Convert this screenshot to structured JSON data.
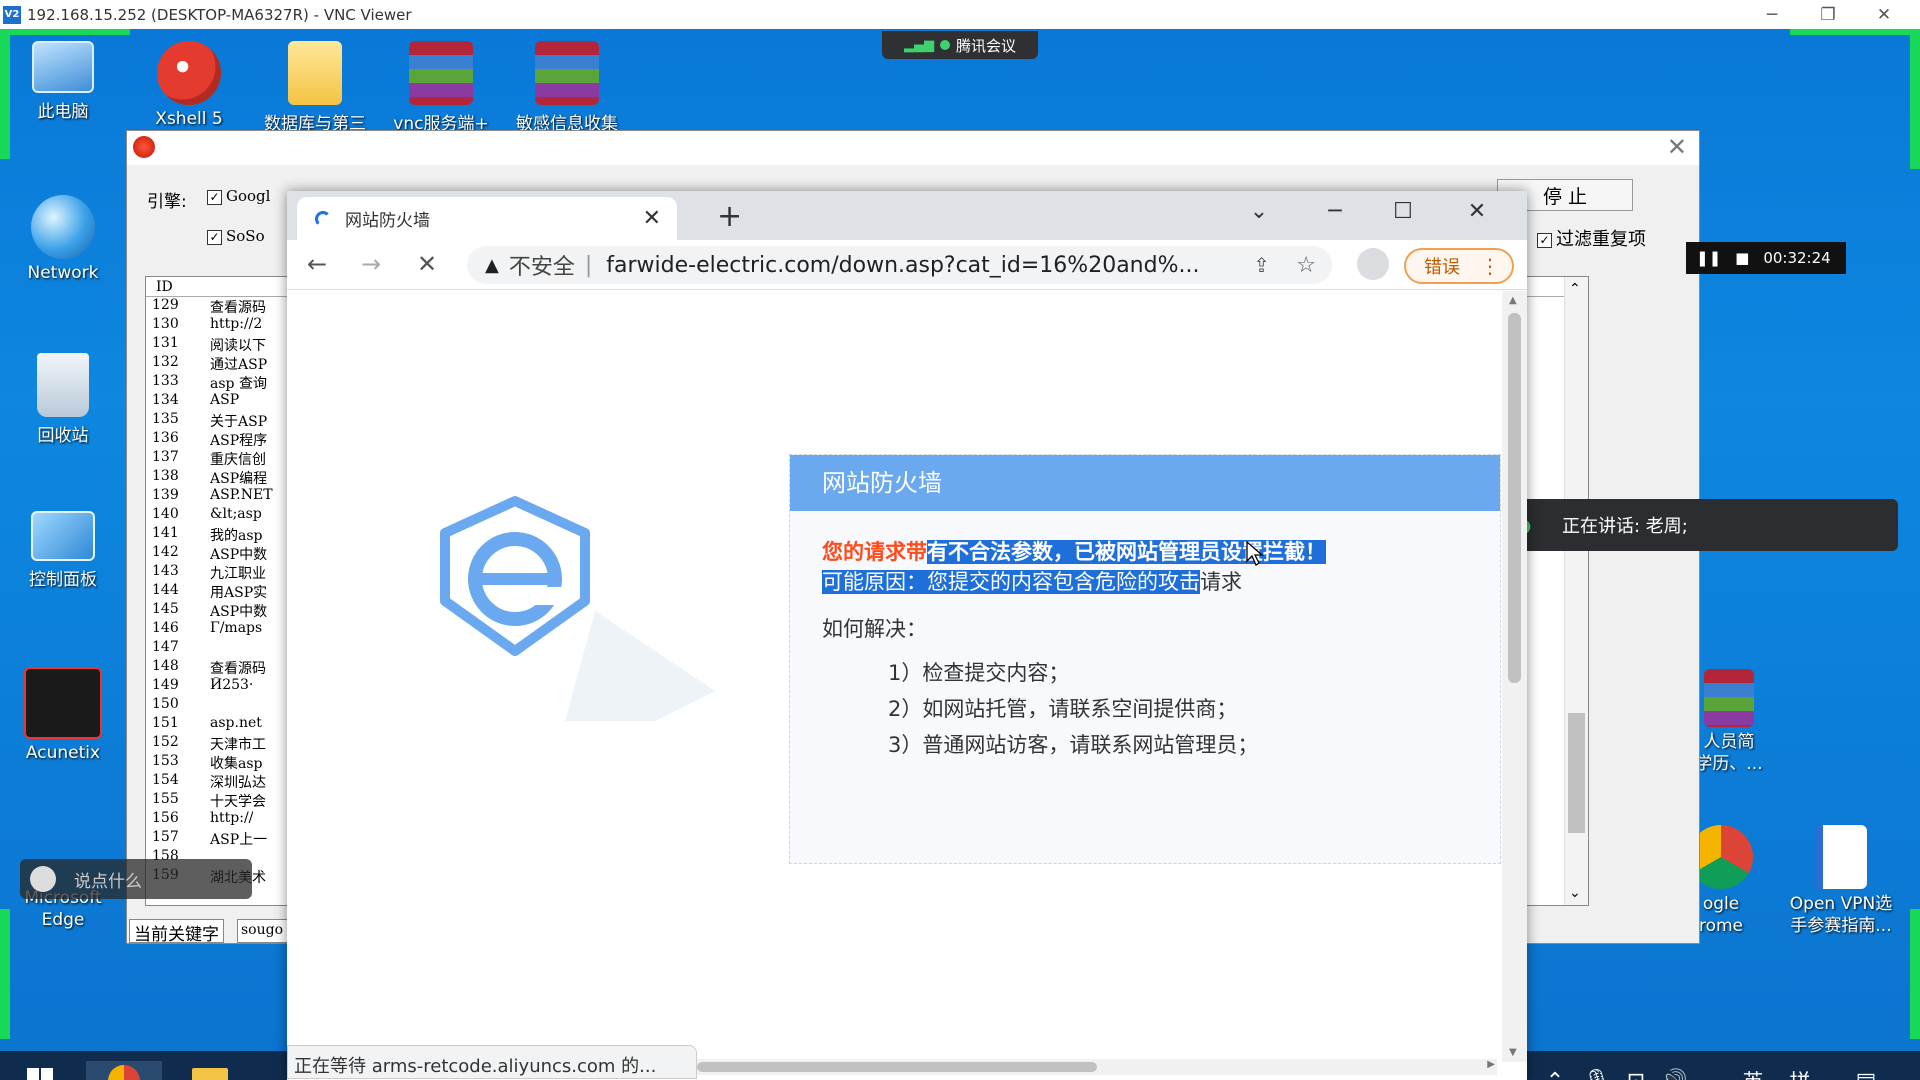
{
  "outer_window": {
    "title": "192.168.15.252 (DESKTOP-MA6327R) - VNC Viewer",
    "app_icon_text": "V2"
  },
  "meeting": {
    "label": "腾讯会议"
  },
  "desktop_icons": [
    {
      "label": "此电脑",
      "icon": "computer-icon"
    },
    {
      "label": "Xshell 5",
      "icon": "xshell-icon"
    },
    {
      "label": "数据库与第三",
      "icon": "folder-icon"
    },
    {
      "label": "vnc服务端+",
      "icon": "winrar-icon"
    },
    {
      "label": "敏感信息收集",
      "icon": "winrar-icon"
    },
    {
      "label": "Network",
      "icon": "network-icon"
    },
    {
      "label": "回收站",
      "icon": "recycle-bin-icon"
    },
    {
      "label": "控制面板",
      "icon": "control-panel-icon"
    },
    {
      "label": "Acunetix",
      "icon": "acunetix-icon"
    },
    {
      "label": "Microsoft Edge",
      "icon": "edge-icon"
    },
    {
      "label": "人员简\n学历、...",
      "icon": "winrar-icon"
    },
    {
      "label": "ogle\nrome",
      "icon": "chrome-icon"
    },
    {
      "label": "Open VPN选\n手参赛指南...",
      "icon": "word-doc-icon"
    }
  ],
  "app": {
    "engine_label": "引擎:",
    "engines": [
      {
        "label": "Googl",
        "checked": true
      },
      {
        "label": "SoSo",
        "checked": true
      }
    ],
    "stop_label": "停 止",
    "filter_label": "过滤重复项",
    "filter_checked": true,
    "list_header": "ID",
    "rows": [
      {
        "id": "129",
        "text": "查看源码"
      },
      {
        "id": "130",
        "text": "http://2"
      },
      {
        "id": "131",
        "text": "阅读以下"
      },
      {
        "id": "132",
        "text": "通过ASP"
      },
      {
        "id": "133",
        "text": "asp 查询"
      },
      {
        "id": "134",
        "text": "ASP"
      },
      {
        "id": "135",
        "text": "关于ASP"
      },
      {
        "id": "136",
        "text": "ASP程序"
      },
      {
        "id": "137",
        "text": "重庆信创"
      },
      {
        "id": "138",
        "text": "ASP编程"
      },
      {
        "id": "139",
        "text": "ASP.NET"
      },
      {
        "id": "140",
        "text": "&lt;asp"
      },
      {
        "id": "141",
        "text": "我的asp"
      },
      {
        "id": "142",
        "text": "ASP中数"
      },
      {
        "id": "143",
        "text": "九江职业"
      },
      {
        "id": "144",
        "text": "用ASP实"
      },
      {
        "id": "145",
        "text": "ASP中数"
      },
      {
        "id": "146",
        "text": "Γ/maps"
      },
      {
        "id": "147",
        "text": ""
      },
      {
        "id": "148",
        "text": "查看源码"
      },
      {
        "id": "149",
        "text": "Ӣ253·"
      },
      {
        "id": "150",
        "text": ""
      },
      {
        "id": "151",
        "text": "asp.net"
      },
      {
        "id": "152",
        "text": "天津市工"
      },
      {
        "id": "153",
        "text": "收集asp"
      },
      {
        "id": "154",
        "text": "深圳弘达"
      },
      {
        "id": "155",
        "text": "十天学会"
      },
      {
        "id": "156",
        "text": "http://"
      },
      {
        "id": "157",
        "text": "ASP上一"
      },
      {
        "id": "158",
        "text": ""
      },
      {
        "id": "159",
        "text": "湖北美术"
      }
    ],
    "current_keyword_label": "当前关键字",
    "current_keyword_value": "sougo"
  },
  "chat_input": {
    "placeholder": "说点什么"
  },
  "recorder": {
    "time": "00:32:24"
  },
  "speaking": {
    "text": "正在讲话: 老周;"
  },
  "browser": {
    "tab_title": "网站防火墙",
    "security_label": "不安全",
    "url": "farwide-electric.com/down.asp?cat_id=16%20and%...",
    "error_button": "错误",
    "status_text": "正在等待 arms-retcode.aliyuncs.com 的..."
  },
  "firewall": {
    "header": "网站防火墙",
    "msg_part1": "您的请求带",
    "msg_part2": "有不合法参数，已被网站管理员设置拦截！",
    "reason_selected": "可能原因：您提交的内容包含危险的攻击",
    "reason_rest": "请求",
    "how_title": "如何解决：",
    "steps": [
      "1）检查提交内容；",
      "2）如网站托管，请联系空间提供商；",
      "3）普通网站访客，请联系网站管理员；"
    ]
  },
  "taskbar": {
    "ime_lang": "英",
    "ime_mode": "拼"
  },
  "colors": {
    "firewall_header": "#6aa8ef",
    "error_red": "#ff4a1a",
    "selection": "#1e6fd9",
    "desktop_blue": "#0b78d6"
  }
}
